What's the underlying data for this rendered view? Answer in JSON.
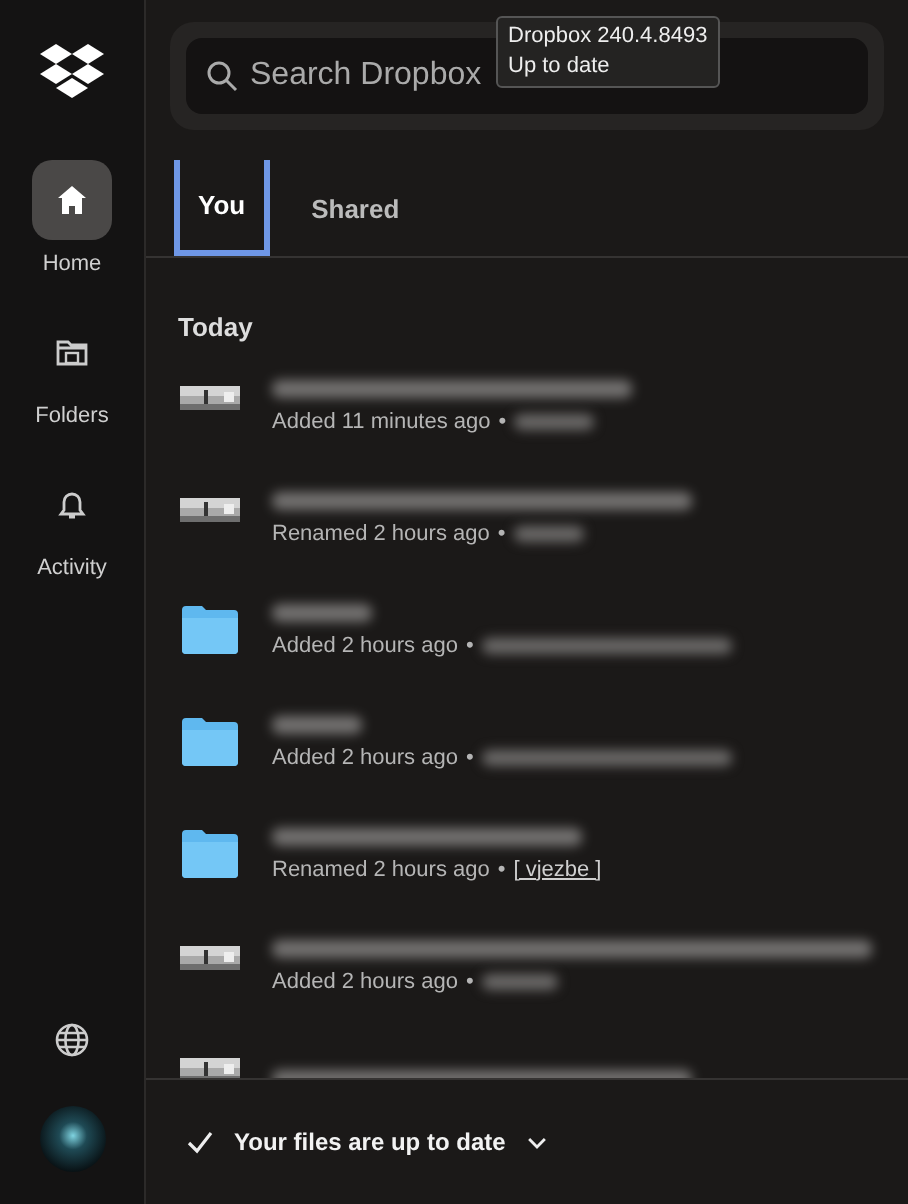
{
  "sidebar": {
    "items": [
      {
        "label": "Home",
        "kind": "home",
        "selected": true
      },
      {
        "label": "Folders",
        "kind": "folders",
        "selected": false
      },
      {
        "label": "Activity",
        "kind": "activity",
        "selected": false
      }
    ]
  },
  "search": {
    "placeholder": "Search Dropbox"
  },
  "tooltip": {
    "lines": [
      "Dropbox 240.4.8493",
      "Up to date"
    ]
  },
  "tabs": [
    {
      "label": "You",
      "selected": true
    },
    {
      "label": "Shared",
      "selected": false
    }
  ],
  "section": "Today",
  "items": [
    {
      "kind": "thumbnail",
      "action": "Added 11 minutes ago",
      "separator": "•"
    },
    {
      "kind": "thumbnail",
      "action": "Renamed 2 hours ago",
      "separator": "•"
    },
    {
      "kind": "folder",
      "action": "Added 2 hours ago",
      "separator": "•"
    },
    {
      "kind": "folder",
      "action": "Added 2 hours ago",
      "separator": "•"
    },
    {
      "kind": "folder",
      "action": "Renamed 2 hours ago",
      "separator": "•",
      "location": "[ vjezbe ]"
    },
    {
      "kind": "thumbnail",
      "action": "Added 2 hours ago",
      "separator": "•"
    },
    {
      "kind": "thumbnail"
    }
  ],
  "status": {
    "text": "Your files are up to date"
  }
}
